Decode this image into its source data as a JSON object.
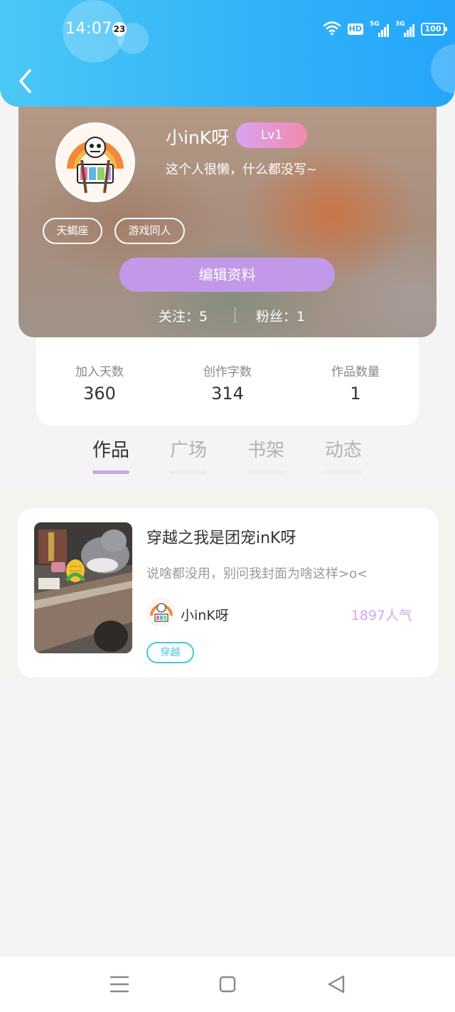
{
  "status_bar": {
    "time": "14:07",
    "notification_count": "23",
    "hd_label": "HD",
    "signal1_label": "5G",
    "signal2_label": "3G",
    "battery": "100"
  },
  "profile": {
    "name": "小inK呀",
    "level": "Lv1",
    "bio": "这个人很懒，什么都没写~",
    "tags": [
      "天蝎座",
      "游戏同人"
    ],
    "edit_label": "编辑资料",
    "following": "关注：5",
    "followers": "粉丝：1"
  },
  "stats": [
    {
      "label": "加入天数",
      "value": "360"
    },
    {
      "label": "创作字数",
      "value": "314"
    },
    {
      "label": "作品数量",
      "value": "1"
    }
  ],
  "tabs": [
    {
      "label": "作品",
      "active": true
    },
    {
      "label": "广场",
      "active": false
    },
    {
      "label": "书架",
      "active": false
    },
    {
      "label": "动态",
      "active": false
    }
  ],
  "works": [
    {
      "title": "穿越之我是团宠inK呀",
      "description": "说啥都没用，别问我封面为啥这样>o<",
      "author": "小inK呀",
      "popularity": "1897人气",
      "tag": "穿越"
    }
  ],
  "colors": {
    "header": "#30b3f8",
    "accent_purple": "#c199e8",
    "level_badge": "#f28aae",
    "tag_teal": "#46c6db",
    "popularity": "#d5a9ee"
  },
  "icons": {
    "back": "back-arrow-icon",
    "wifi": "wifi-icon",
    "nav": [
      "menu-icon",
      "home-square-icon",
      "back-triangle-icon"
    ]
  }
}
